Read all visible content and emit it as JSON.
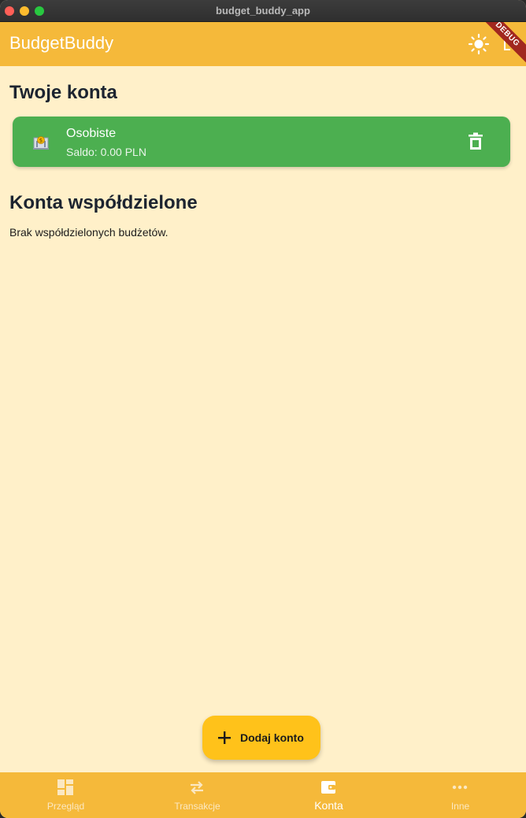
{
  "window": {
    "title": "budget_buddy_app"
  },
  "appbar": {
    "title": "BudgetBuddy",
    "debug_banner": "DEBUG",
    "theme_icon": "sun-icon",
    "logout_icon": "logout-icon"
  },
  "own_accounts": {
    "title": "Twoje konta",
    "items": [
      {
        "name": "Osobiste",
        "balance": "Saldo: 0.00 PLN",
        "icon": "bank-icon",
        "action_icon": "delete-icon"
      }
    ]
  },
  "shared_accounts": {
    "title": "Konta współdzielone",
    "empty_text": "Brak współdzielonych budżetów."
  },
  "fab": {
    "label": "Dodaj konto",
    "icon": "plus-icon"
  },
  "bottom_nav": {
    "items": [
      {
        "label": "Przegląd",
        "icon": "dashboard-icon",
        "active": false
      },
      {
        "label": "Transakcje",
        "icon": "swap-icon",
        "active": false
      },
      {
        "label": "Konta",
        "icon": "wallet-icon",
        "active": true
      },
      {
        "label": "Inne",
        "icon": "more-icon",
        "active": false
      }
    ]
  },
  "colors": {
    "appbar": "#F5B93A",
    "background": "#FFF0C9",
    "card": "#4CAF50",
    "fab": "#FFC21A",
    "debug": "#A1271F"
  }
}
